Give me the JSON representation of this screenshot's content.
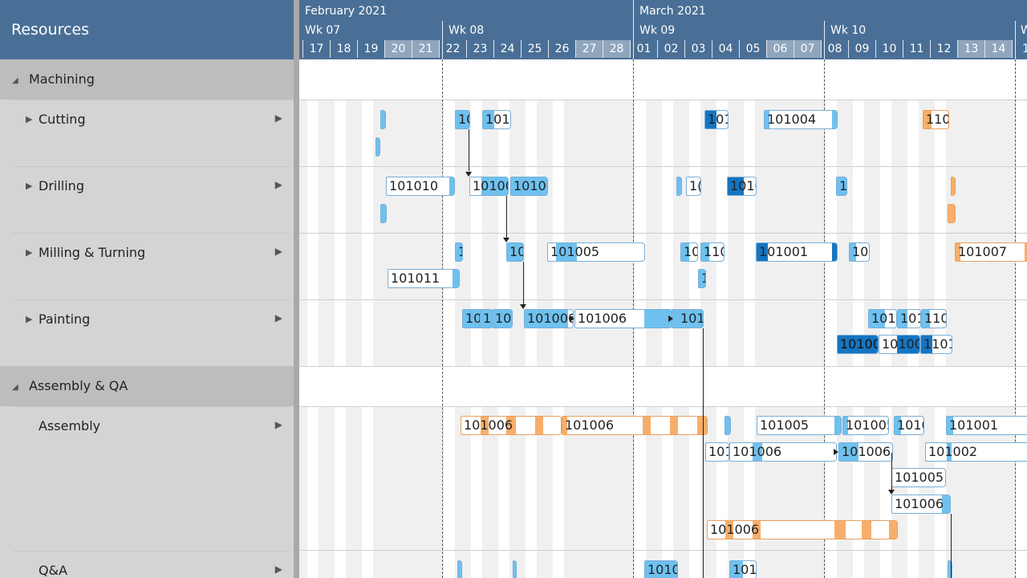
{
  "resources_panel": {
    "title": "Resources",
    "groups": [
      {
        "name": "Machining",
        "resources": [
          "Cutting",
          "Drilling",
          "Milling & Turning",
          "Painting"
        ]
      },
      {
        "name": "Assembly & QA",
        "resources": [
          "Assembly",
          "Q&A"
        ]
      }
    ]
  },
  "timeline": {
    "months": [
      "February 2021",
      "March 2021"
    ],
    "weeks": [
      "Wk 07",
      "Wk 08",
      "Wk 09",
      "Wk 10",
      "W"
    ],
    "days": [
      "17",
      "18",
      "19",
      "20",
      "21",
      "22",
      "23",
      "24",
      "25",
      "26",
      "27",
      "28",
      "01",
      "02",
      "03",
      "04",
      "05",
      "06",
      "07",
      "08",
      "09",
      "10",
      "11",
      "12",
      "13",
      "14",
      "1"
    ],
    "weekend_days": [
      "20",
      "21",
      "27",
      "28",
      "06",
      "07",
      "13",
      "14"
    ]
  },
  "colors": {
    "header_bg": "#4a6f96",
    "task_light": "#6ec1ef",
    "task_dark": "#1575c2",
    "task_orange": "#f7ae6a"
  },
  "tasks": {
    "cutting": [
      "1",
      "10",
      "1010",
      "101",
      "101004",
      "110"
    ],
    "drilling": [
      "101010",
      "10100",
      "10100",
      "1(",
      "1010",
      "1("
    ],
    "milling": [
      "1",
      "10",
      "101005",
      "10",
      "110",
      "101001",
      "101",
      "101007",
      "101011",
      "1"
    ],
    "painting": [
      "101",
      "1(",
      "10",
      "101006",
      "101006",
      "101",
      "101",
      "101",
      "110",
      "10100",
      "10100",
      "1101("
    ],
    "assembly": [
      "101006",
      "101006",
      "101005",
      "101005",
      "1010",
      "101001",
      "101",
      "101006",
      "101006",
      "101002",
      "101005",
      "101006",
      "101006"
    ],
    "qa": [
      "1010",
      "101("
    ]
  }
}
